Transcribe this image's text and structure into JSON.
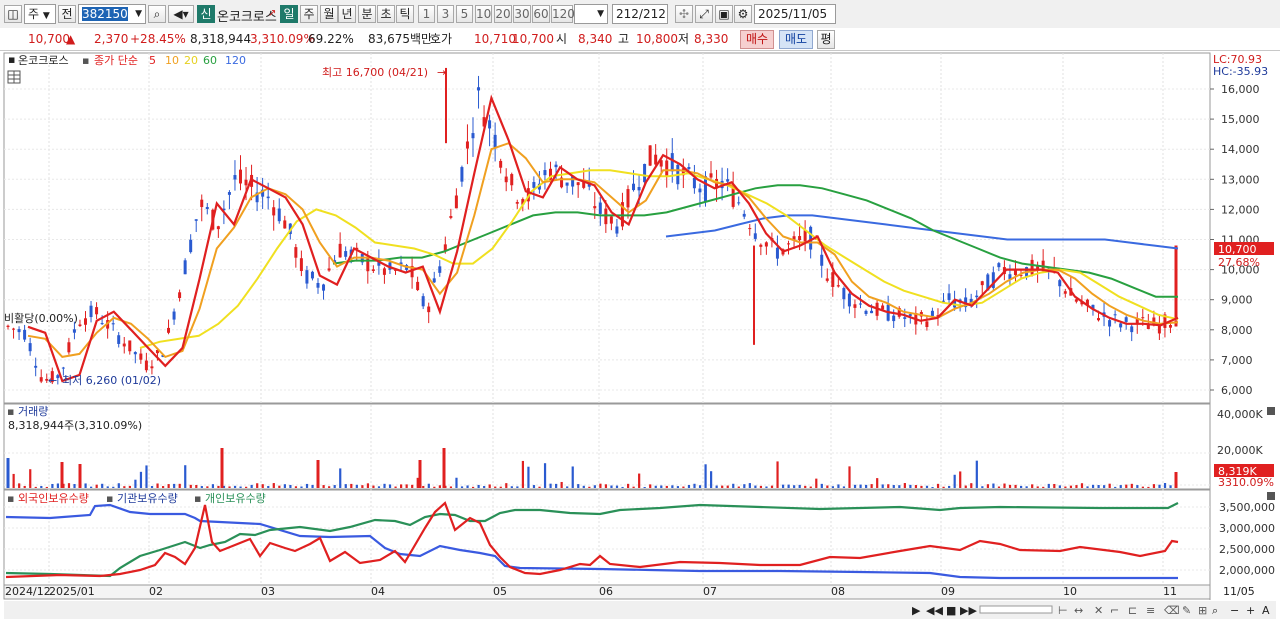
{
  "toolbar": {
    "period_type": "주",
    "scope": "전",
    "code": "382150",
    "name_tag": "신",
    "stock_name": "온코크로스",
    "period_tabs": [
      "일",
      "주",
      "월",
      "년",
      "분",
      "초",
      "틱"
    ],
    "active_period": "일",
    "interval_buttons": [
      "1",
      "3",
      "5",
      "10",
      "20",
      "30",
      "60",
      "120"
    ],
    "count_display": "212/212",
    "date": "2025/11/05"
  },
  "quote": {
    "price": "10,700",
    "change_arrow": "▲",
    "change": "2,370",
    "change_pct": "+28.45%",
    "volume": "8,318,944",
    "volume_ratio": "3,310.09%",
    "turnover_pct": "69.22%",
    "amount": "83,675백만",
    "hoga_label": "호가",
    "ask": "10,710",
    "bid": "10,700",
    "open_label": "시",
    "open": "8,340",
    "high_label": "고",
    "high": "10,800",
    "low_label": "저",
    "low": "8,330",
    "buy_button": "매수",
    "sell_button": "매도",
    "eval_button": "평"
  },
  "price_pane": {
    "name": "온코크로스",
    "ma_label": "종가 단순",
    "ma_periods": [
      "5",
      "10",
      "20",
      "60",
      "120"
    ],
    "ma_colors": [
      "#e02020",
      "#f0a020",
      "#f0e020",
      "#28a040",
      "#3a6ae0"
    ],
    "lc": "LC:70.93",
    "hc": "HC:-35.93",
    "high_annotation": "최고 16,700 (04/21)",
    "low_annotation": "최저 6,260 (01/02)",
    "trade_status": "비활당(0.00%)",
    "current_price_tag": "10,700",
    "current_pct_tag": "27.68%",
    "y_ticks": [
      "16,000",
      "15,000",
      "14,000",
      "13,000",
      "12,000",
      "11,000",
      "10,000",
      "9,000",
      "8,000",
      "7,000",
      "6,000"
    ]
  },
  "volume_pane": {
    "title": "거래량",
    "value_text": "8,318,944주(3,310.09%)",
    "y_ticks": [
      "40,000K",
      "20,000K"
    ],
    "current_tag": "8,319K",
    "current_pct": "3310.09%"
  },
  "holdings_pane": {
    "series_labels": [
      "외국인보유수량",
      "기관보유수량",
      "개인보유수량"
    ],
    "y_ticks": [
      "3,500,000",
      "3,000,000",
      "2,500,000",
      "2,000,000"
    ]
  },
  "x_axis": {
    "labels": [
      "2024/12",
      "2025/01",
      "02",
      "03",
      "04",
      "05",
      "06",
      "07",
      "08",
      "09",
      "10",
      "11",
      "11/05"
    ]
  },
  "chart_data": {
    "type": "line",
    "series": [
      {
        "name": "5",
        "color": "#e02020",
        "values": [
          8100,
          7900,
          6300,
          6500,
          8300,
          8600,
          8000,
          7400,
          6800,
          7400,
          9700,
          12200,
          11500,
          13000,
          12700,
          12400,
          11500,
          9800,
          9500,
          10700,
          10400,
          10100,
          9900,
          10100,
          8600,
          10600,
          13200,
          15700,
          14300,
          12600,
          12400,
          13400,
          13000,
          12800,
          11900,
          11500,
          12900,
          13800,
          13500,
          13000,
          12700,
          12900,
          12200,
          11200,
          10600,
          10800,
          11100,
          9900,
          9200,
          8800,
          8600,
          8500,
          8300,
          8400,
          9000,
          8800,
          9400,
          10000,
          10000,
          10000,
          9900,
          9100,
          8700,
          8400,
          8200,
          8200,
          8150,
          8400
        ]
      },
      {
        "name": "10",
        "color": "#f0a020",
        "values": [
          7800,
          7700,
          7100,
          7200,
          7900,
          8400,
          8200,
          7700,
          7100,
          7300,
          8700,
          10700,
          11400,
          12400,
          12700,
          12500,
          12000,
          10900,
          10100,
          10400,
          10400,
          10300,
          10100,
          10000,
          9200,
          9900,
          11800,
          14000,
          14200,
          13700,
          12900,
          13000,
          13000,
          12900,
          12400,
          11900,
          12300,
          13300,
          13300,
          13200,
          12900,
          12800,
          12400,
          11700,
          11100,
          10900,
          10900,
          10500,
          9600,
          9100,
          8900,
          8600,
          8500,
          8400,
          8700,
          8900,
          9200,
          9600,
          9900,
          10000,
          10000,
          9700,
          9200,
          8800,
          8500,
          8300,
          8200,
          8250
        ]
      },
      {
        "name": "20",
        "color": "#f0e020",
        "values": [
          7400,
          7600,
          7700,
          7800,
          8200,
          8800,
          9700,
          10700,
          11600,
          12000,
          11800,
          11400,
          10900,
          10800,
          10700,
          10500,
          10200,
          10200,
          10700,
          11600,
          12600,
          13100,
          13200,
          13300,
          13300,
          13200,
          13100,
          13100,
          13200,
          13000,
          12800,
          12500,
          12200,
          11800,
          11300,
          10800,
          10400,
          10000,
          9600,
          9300,
          9100,
          8900,
          8800,
          8900,
          9300,
          9700,
          9900,
          10000,
          9900,
          9500,
          9100,
          8800,
          8500,
          8350
        ]
      },
      {
        "name": "60",
        "color": "#28a040",
        "values": [
          10200,
          10300,
          10300,
          10400,
          10400,
          10600,
          10900,
          11200,
          11500,
          11800,
          11900,
          11900,
          11800,
          11800,
          11800,
          11900,
          12100,
          12300,
          12500,
          12700,
          12800,
          12800,
          12700,
          12500,
          12300,
          12000,
          11700,
          11300,
          11000,
          10700,
          10400,
          10200,
          10100,
          10000,
          9900,
          9700,
          9400,
          9100,
          9100
        ]
      },
      {
        "name": "120",
        "color": "#3a6ae0",
        "values": [
          11100,
          11200,
          11300,
          11500,
          11700,
          11800,
          11800,
          11700,
          11600,
          11500,
          11400,
          11300,
          11200,
          11100,
          11000,
          11000,
          11000,
          11000,
          11000,
          10900,
          10800,
          10700
        ]
      }
    ],
    "ylim": [
      5800,
      16700
    ]
  }
}
